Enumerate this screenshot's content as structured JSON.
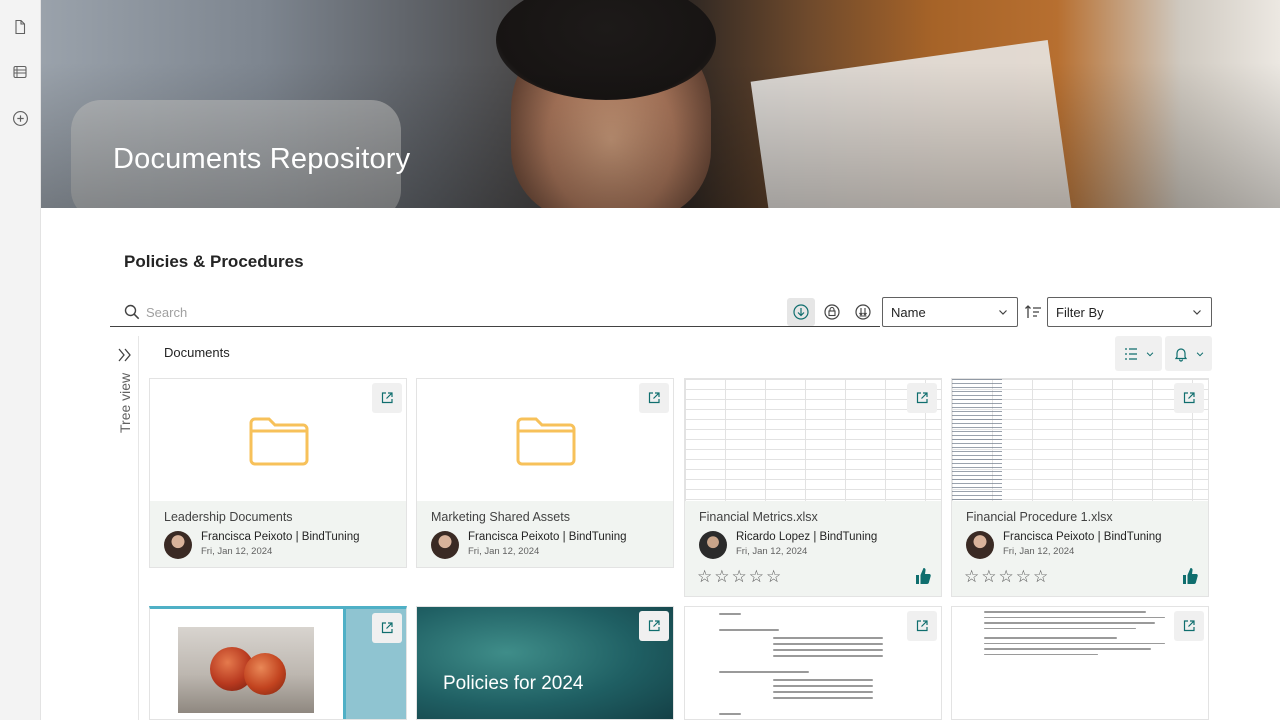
{
  "hero": {
    "title": "Documents Repository"
  },
  "section": {
    "title": "Policies & Procedures"
  },
  "search": {
    "placeholder": "Search"
  },
  "sort_select": {
    "value": "Name"
  },
  "filter_select": {
    "value": "Filter By"
  },
  "tree": {
    "label": "Tree view"
  },
  "breadcrumb": {
    "current": "Documents"
  },
  "cards": [
    {
      "name": "Leadership Documents",
      "author": "Francisca Peixoto | BindTuning",
      "date": "Fri, Jan 12, 2024"
    },
    {
      "name": "Marketing Shared Assets",
      "author": "Francisca Peixoto | BindTuning",
      "date": "Fri, Jan 12, 2024"
    },
    {
      "name": "Financial Metrics.xlsx",
      "author": "Ricardo Lopez | BindTuning",
      "date": "Fri, Jan 12, 2024",
      "rating": 0
    },
    {
      "name": "Financial Procedure 1.xlsx",
      "author": "Francisca Peixoto | BindTuning",
      "date": "Fri, Jan 12, 2024",
      "rating": 0
    }
  ],
  "previews": {
    "slide_title": "Policies for 2024"
  },
  "colors": {
    "accent": "#0f6e6e",
    "folder": "#f7c15a",
    "hero_text": "#ffffff"
  }
}
